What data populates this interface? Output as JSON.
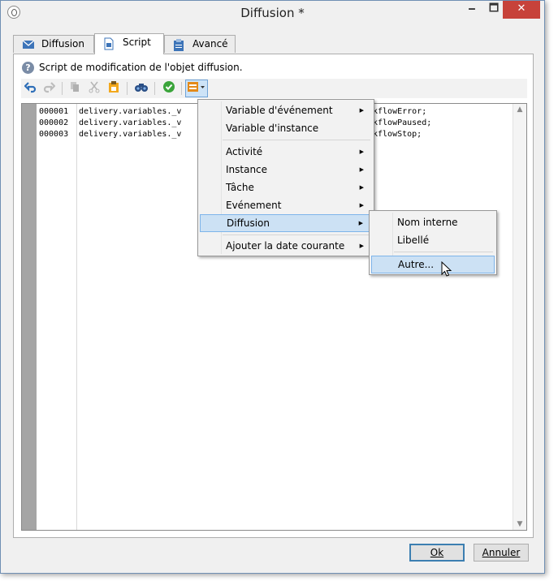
{
  "window": {
    "title": "Diffusion *",
    "minimize_label": "🗕",
    "maximize_label": "🗖",
    "close_label": "✕"
  },
  "tabs": [
    {
      "label": "Diffusion",
      "icon": "envelope-icon",
      "active": false
    },
    {
      "label": "Script",
      "icon": "script-document-icon",
      "active": true
    },
    {
      "label": "Avancé",
      "icon": "clipboard-icon",
      "active": false
    }
  ],
  "info": {
    "text": "Script de modification de l'objet diffusion.",
    "icon": "question-icon"
  },
  "toolbar": {
    "icons": [
      "undo-icon",
      "redo-icon",
      "copy-icon",
      "cut-icon",
      "paste-icon",
      "search-binoculars-icon",
      "check-icon",
      "insert-field-icon"
    ]
  },
  "editor": {
    "lines": [
      {
        "num": "000001",
        "start": "delivery.variables._v",
        "end": "kflowError;"
      },
      {
        "num": "000002",
        "start": "delivery.variables._v",
        "end": "kflowPaused;"
      },
      {
        "num": "000003",
        "start": "delivery.variables._v",
        "end": "kflowStop;"
      }
    ]
  },
  "context_menu": {
    "items": [
      {
        "label": "Variable d'événement",
        "submenu": true
      },
      {
        "label": "Variable d'instance",
        "submenu": false
      },
      {
        "label": "Activité",
        "submenu": true
      },
      {
        "label": "Instance",
        "submenu": true
      },
      {
        "label": "Tâche",
        "submenu": true
      },
      {
        "label": "Evénement",
        "submenu": true
      },
      {
        "label": "Diffusion",
        "submenu": true,
        "highlighted": true
      },
      {
        "label": "Ajouter la date courante",
        "submenu": true
      }
    ]
  },
  "submenu": {
    "items": [
      {
        "label": "Nom interne"
      },
      {
        "label": "Libellé"
      },
      {
        "label": "Autre...",
        "highlighted": true
      }
    ]
  },
  "buttons": {
    "ok": "Ok",
    "cancel": "Annuler"
  }
}
